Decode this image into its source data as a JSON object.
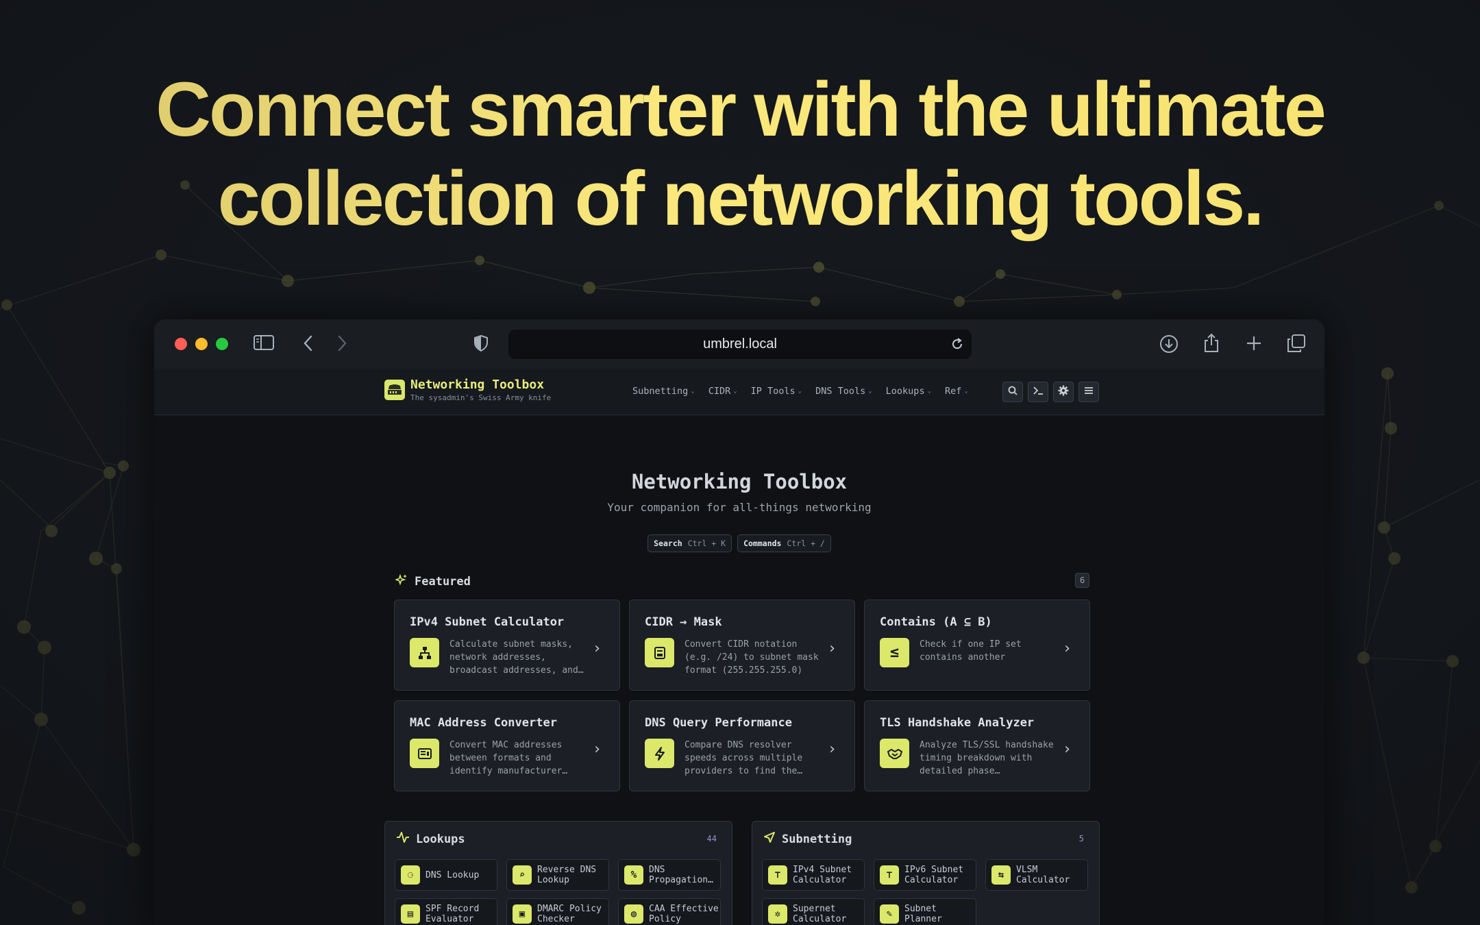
{
  "headline": {
    "line1": "Connect smarter with the ultimate",
    "line2": "collection of networking tools."
  },
  "browser": {
    "url": "umbrel.local",
    "colors": {
      "close": "#ff5f57",
      "minimize": "#febc2e",
      "zoom": "#28c840"
    }
  },
  "app": {
    "brand": {
      "title": "Networking Toolbox",
      "subtitle": "The sysadmin's Swiss Army knife"
    },
    "nav": [
      "Subnetting",
      "CIDR",
      "IP Tools",
      "DNS Tools",
      "Lookups",
      "Ref"
    ],
    "nav_buttons": [
      "search-icon",
      "terminal-icon",
      "gear-icon",
      "menu-icon"
    ]
  },
  "hero": {
    "title": "Networking Toolbox",
    "subtitle": "Your companion for all-things networking",
    "shortcuts": [
      {
        "label": "Search",
        "keys": "Ctrl + K"
      },
      {
        "label": "Commands",
        "keys": "Ctrl + /"
      }
    ]
  },
  "featured": {
    "title": "Featured",
    "count": "6",
    "cards": [
      {
        "title": "IPv4 Subnet Calculator",
        "desc": "Calculate subnet masks, network addresses, broadcast addresses, and…",
        "icon": "network-tree-icon"
      },
      {
        "title": "CIDR → Mask",
        "desc": "Convert CIDR notation (e.g. /24) to subnet mask format (255.255.255.0)",
        "icon": "mask-icon"
      },
      {
        "title": "Contains (A ⊆ B)",
        "desc": "Check if one IP set contains another",
        "icon": "subset-icon"
      },
      {
        "title": "MAC Address Converter",
        "desc": "Convert MAC addresses between formats and identify manufacturer…",
        "icon": "mac-card-icon"
      },
      {
        "title": "DNS Query Performance",
        "desc": "Compare DNS resolver speeds across multiple providers to find the…",
        "icon": "lightning-icon"
      },
      {
        "title": "TLS Handshake Analyzer",
        "desc": "Analyze TLS/SSL handshake timing breakdown with detailed phase…",
        "icon": "handshake-icon"
      }
    ]
  },
  "lookups": {
    "title": "Lookups",
    "count": "44",
    "tools": [
      {
        "label": "DNS Lookup",
        "icon": "binoculars-icon"
      },
      {
        "label": "Reverse DNS Lookup",
        "icon": "telescope-icon"
      },
      {
        "label": "DNS Propagation…",
        "icon": "percent-icon"
      },
      {
        "label": "SPF Record Evaluator",
        "icon": "record-icon"
      },
      {
        "label": "DMARC Policy Checker",
        "icon": "policy-icon"
      },
      {
        "label": "CAA Effective Policy",
        "icon": "globe-icon"
      }
    ]
  },
  "subnetting": {
    "title": "Subnetting",
    "count": "5",
    "tools": [
      {
        "label": "IPv4 Subnet Calculator",
        "icon": "network-tree-icon"
      },
      {
        "label": "IPv6 Subnet Calculator",
        "icon": "network-tree-icon"
      },
      {
        "label": "VLSM Calculator",
        "icon": "arrows-icon"
      },
      {
        "label": "Supernet Calculator",
        "icon": "merge-icon"
      },
      {
        "label": "Subnet Planner",
        "icon": "pencil-icon"
      }
    ]
  }
}
